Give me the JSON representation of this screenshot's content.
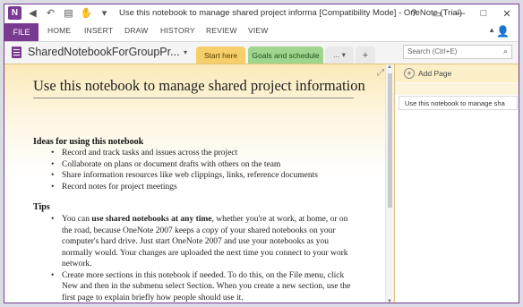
{
  "window": {
    "title": "Use this notebook to manage shared project informa [Compatibility Mode] - OneNote (Trial)",
    "help": "?",
    "restore": "▭",
    "minimize": "—",
    "maximize": "□",
    "close": "✕"
  },
  "quick_access": {
    "app_icon": "N",
    "back": "◀",
    "undo": "↶",
    "clip": "▤",
    "touch": "✋",
    "more": "▾"
  },
  "ribbon": {
    "file": "FILE",
    "tabs": [
      "HOME",
      "INSERT",
      "DRAW",
      "HISTORY",
      "REVIEW",
      "VIEW"
    ],
    "collapse": "▲",
    "user": "👤"
  },
  "notebook": {
    "name": "SharedNotebookForGroupPr...",
    "caret": "▾"
  },
  "sections": {
    "start": "Start here",
    "goals": "Goals and schedule",
    "more": "... ▾",
    "add": "+"
  },
  "search": {
    "placeholder": "Search (Ctrl+E)",
    "icon": "⌕"
  },
  "page": {
    "expand": "⤢",
    "title": "Use this notebook to manage shared project information",
    "ideas_heading": "Ideas for using this notebook",
    "ideas": [
      "Record and track tasks and issues across the project",
      "Collaborate on plans or document drafts with others on the team",
      "Share information resources like web clippings, links, reference documents",
      "Record notes for project meetings"
    ],
    "tips_heading": "Tips",
    "tip1_pre": "You can ",
    "tip1_bold": "use shared notebooks at any time",
    "tip1_post": ", whether you're at work, at home, or on the road, because OneNote 2007 keeps a copy of your shared notebooks on your computer's hard drive. Just start OneNote 2007 and use your notebooks as you normally would. Your changes are uploaded the next time you connect to your work network.",
    "tip2": "Create more sections in this notebook if needed. To do this, on the File menu, click New and then in the submenu select Section. When you create a new section, use the first page to explain briefly how people should use it."
  },
  "pane": {
    "add_page": "Add Page",
    "add_icon": "+",
    "page_tab": "Use this notebook to manage sha"
  },
  "colors": {
    "accent": "#7a3a92",
    "section_start": "#f6cf6a",
    "section_goals": "#9fd58f"
  }
}
